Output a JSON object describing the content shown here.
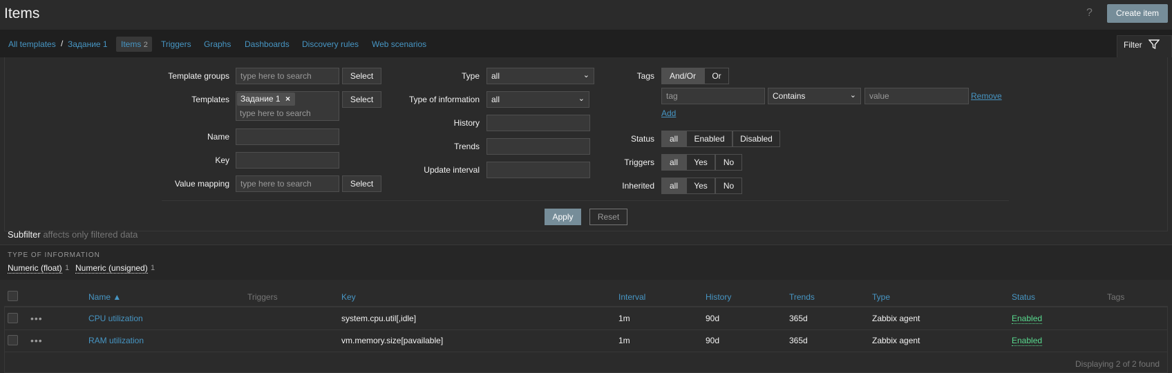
{
  "header": {
    "title": "Items",
    "help": "?",
    "create_button": "Create item"
  },
  "nav": {
    "all_templates": "All templates",
    "separator": "/",
    "template": "Задание 1",
    "items": "Items",
    "items_count": "2",
    "triggers": "Triggers",
    "graphs": "Graphs",
    "dashboards": "Dashboards",
    "discovery": "Discovery rules",
    "web": "Web scenarios",
    "filter_tab": "Filter"
  },
  "filter": {
    "template_groups_label": "Template groups",
    "templates_label": "Templates",
    "name_label": "Name",
    "key_label": "Key",
    "value_mapping_label": "Value mapping",
    "search_placeholder": "type here to search",
    "select": "Select",
    "template_chip": "Задание 1",
    "chip_remove": "×",
    "type_label": "Type",
    "type_value": "all",
    "type_info_label": "Type of information",
    "type_info_value": "all",
    "history_label": "History",
    "trends_label": "Trends",
    "update_interval_label": "Update interval",
    "tags_label": "Tags",
    "andor": "And/Or",
    "or": "Or",
    "tag_placeholder": "tag",
    "tag_operator": "Contains",
    "value_placeholder": "value",
    "remove": "Remove",
    "add": "Add",
    "status_label": "Status",
    "triggers_label": "Triggers",
    "inherited_label": "Inherited",
    "all": "all",
    "enabled": "Enabled",
    "disabled": "Disabled",
    "yes": "Yes",
    "no": "No",
    "apply": "Apply",
    "reset": "Reset"
  },
  "subfilter": {
    "title": "Subfilter",
    "note": "affects only filtered data",
    "section": "TYPE OF INFORMATION",
    "items": [
      {
        "label": "Numeric (float)",
        "count": "1"
      },
      {
        "label": "Numeric (unsigned)",
        "count": "1"
      }
    ]
  },
  "table": {
    "columns": [
      "Name ▲",
      "Triggers",
      "Key",
      "Interval",
      "History",
      "Trends",
      "Type",
      "Status",
      "Tags"
    ],
    "rows": [
      {
        "name": "CPU utilization",
        "key": "system.cpu.util[,idle]",
        "interval": "1m",
        "history": "90d",
        "trends": "365d",
        "type": "Zabbix agent",
        "status": "Enabled"
      },
      {
        "name": "RAM utilization",
        "key": "vm.memory.size[pavailable]",
        "interval": "1m",
        "history": "90d",
        "trends": "365d",
        "type": "Zabbix agent",
        "status": "Enabled"
      }
    ],
    "row_menu": "•••",
    "footer": "Displaying 2 of 2 found"
  }
}
